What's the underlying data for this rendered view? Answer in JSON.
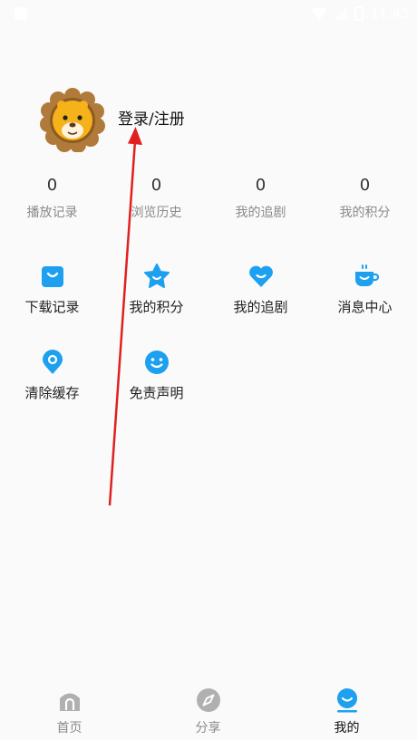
{
  "status_bar": {
    "time": "11:45"
  },
  "profile": {
    "login_label": "登录/注册"
  },
  "stats": [
    {
      "value": "0",
      "label": "播放记录"
    },
    {
      "value": "0",
      "label": "浏览历史"
    },
    {
      "value": "0",
      "label": "我的追剧"
    },
    {
      "value": "0",
      "label": "我的积分"
    }
  ],
  "menu": [
    {
      "label": "下载记录",
      "icon": "shopping-bag-icon"
    },
    {
      "label": "我的积分",
      "icon": "star-icon"
    },
    {
      "label": "我的追剧",
      "icon": "heart-icon"
    },
    {
      "label": "消息中心",
      "icon": "cup-icon"
    },
    {
      "label": "清除缓存",
      "icon": "location-pin-icon"
    },
    {
      "label": "免责声明",
      "icon": "smiley-icon"
    }
  ],
  "tabs": [
    {
      "label": "首页",
      "icon": "home-icon"
    },
    {
      "label": "分享",
      "icon": "compass-icon"
    },
    {
      "label": "我的",
      "icon": "profile-icon"
    }
  ],
  "colors": {
    "accent": "#1ea0f0",
    "annotation_arrow": "#e02020",
    "tab_inactive": "#b0b0b0"
  }
}
